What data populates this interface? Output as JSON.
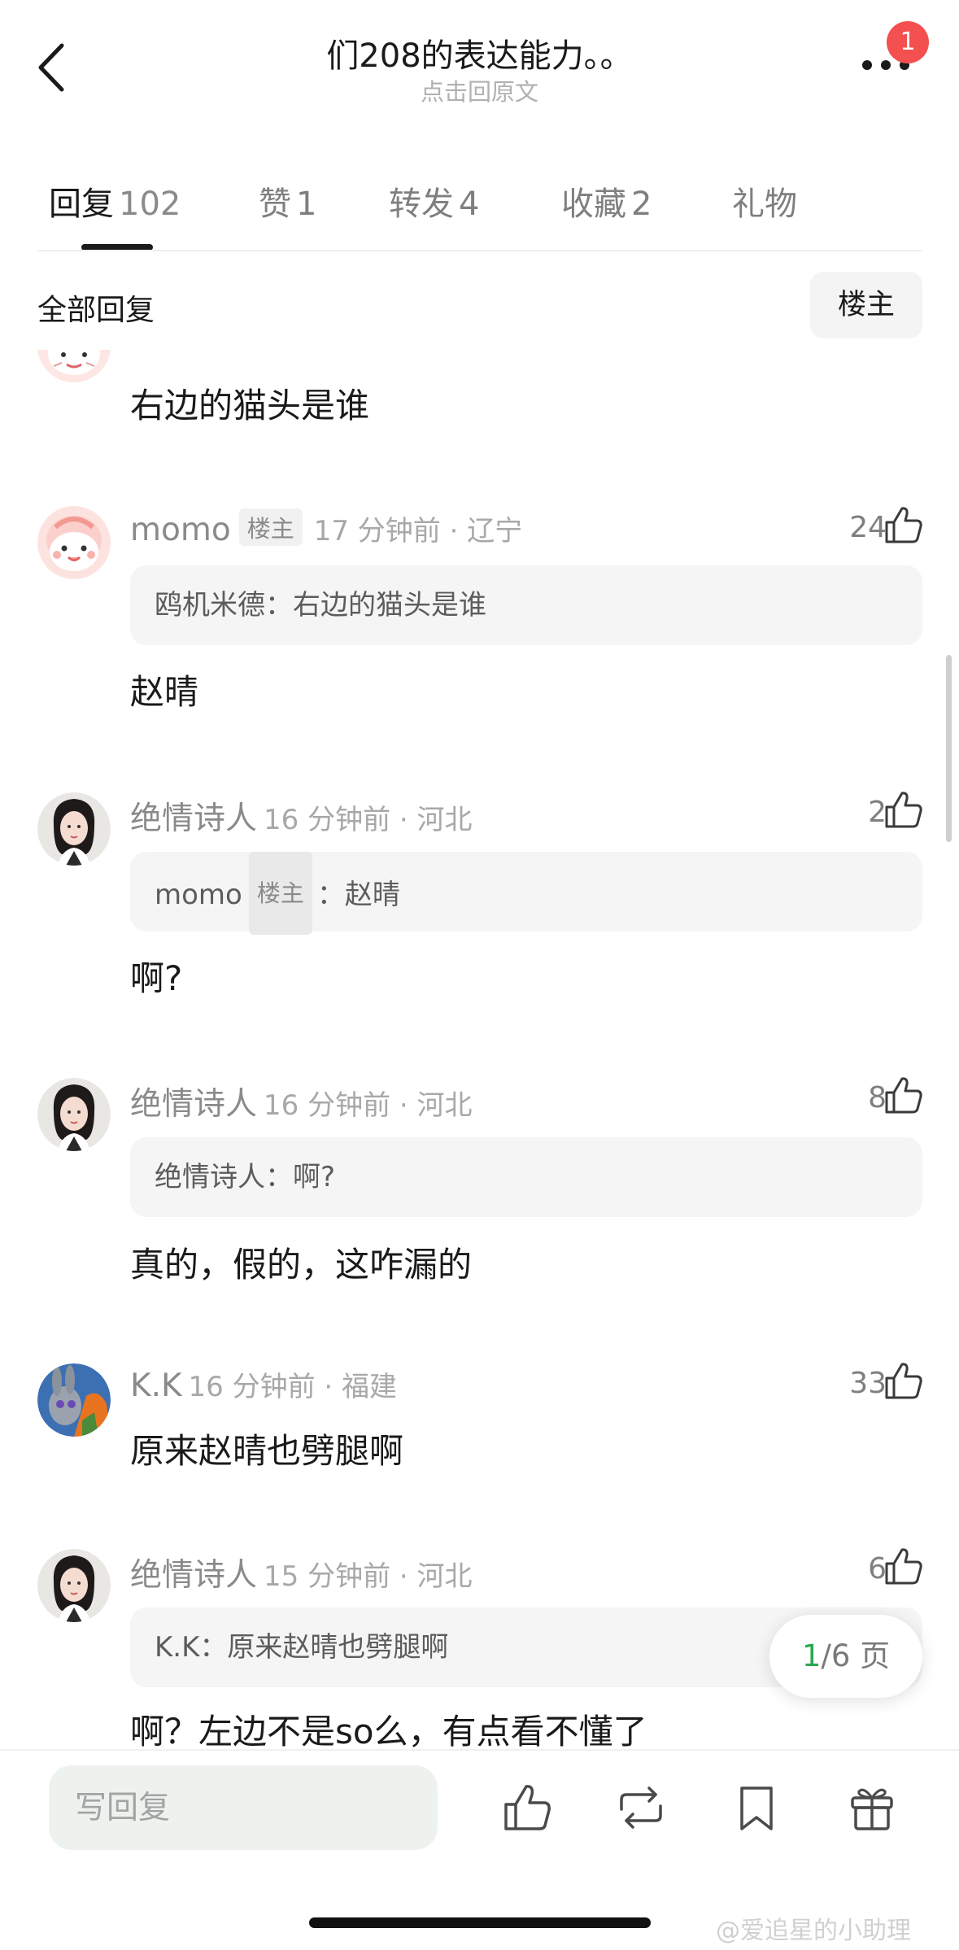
{
  "header": {
    "title": "们208的表达能力。。",
    "subtitle": "点击回原文",
    "notification_badge": "1"
  },
  "tabs": [
    {
      "label": "回复",
      "count": "102"
    },
    {
      "label": "赞",
      "count": "1"
    },
    {
      "label": "转发",
      "count": "4"
    },
    {
      "label": "收藏",
      "count": "2"
    },
    {
      "label": "礼物",
      "count": ""
    }
  ],
  "section": {
    "title": "全部回复",
    "filter_label": "楼主"
  },
  "comments": [
    {
      "name": "",
      "badge": "",
      "meta": "",
      "likes": "",
      "quote": null,
      "text": "右边的猫头是谁"
    },
    {
      "name": "momo",
      "badge": "楼主",
      "meta": "17 分钟前 · 辽宁",
      "likes": "24",
      "quote": {
        "author": "鸥机米德",
        "badge": "",
        "sep": "：",
        "text": "右边的猫头是谁"
      },
      "text": "赵晴"
    },
    {
      "name": "绝情诗人",
      "badge": "",
      "meta": "16 分钟前 · 河北",
      "likes": "2",
      "quote": {
        "author": "momo",
        "badge": "楼主",
        "sep": "：",
        "text": "赵晴"
      },
      "text": "啊?"
    },
    {
      "name": "绝情诗人",
      "badge": "",
      "meta": "16 分钟前 · 河北",
      "likes": "8",
      "quote": {
        "author": "绝情诗人",
        "badge": "",
        "sep": "：",
        "text": "啊?"
      },
      "text": "真的，假的，这咋漏的"
    },
    {
      "name": "K.K",
      "badge": "",
      "meta": "16 分钟前 · 福建",
      "likes": "33",
      "quote": null,
      "text": "原来赵晴也劈腿啊"
    },
    {
      "name": "绝情诗人",
      "badge": "",
      "meta": "15 分钟前 · 河北",
      "likes": "6",
      "quote": {
        "author": "K.K",
        "badge": "",
        "sep": "：",
        "text": "原来赵晴也劈腿啊"
      },
      "text": "啊？左边不是so么，有点看不懂了"
    }
  ],
  "pagination": {
    "current": "1",
    "total": "/6 页"
  },
  "bottom_bar": {
    "reply_placeholder": "写回复",
    "icons": [
      "like-icon",
      "repost-icon",
      "bookmark-icon",
      "gift-icon"
    ]
  },
  "watermark": "@爱追星的小助理",
  "colors": {
    "badge": "#f4504f",
    "page_current": "#2aaa52",
    "input_bg": "#eef2ee"
  }
}
